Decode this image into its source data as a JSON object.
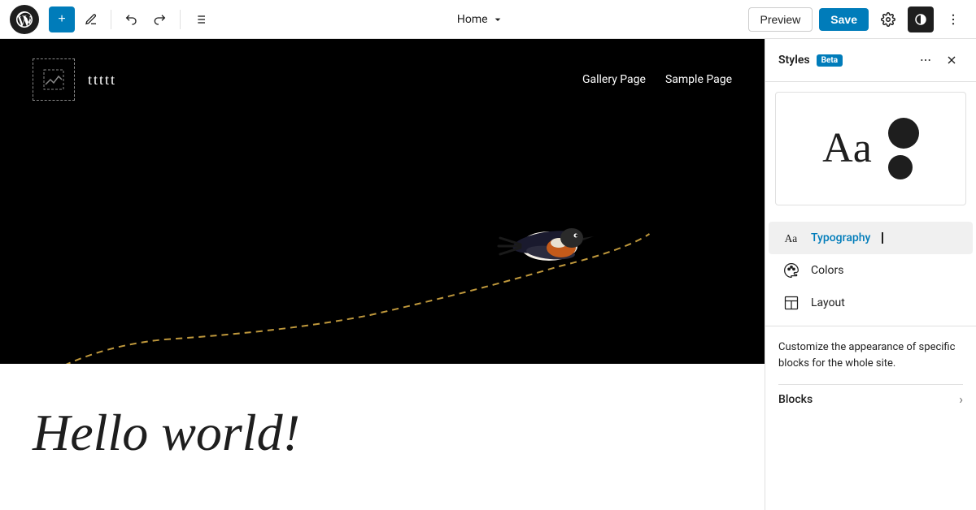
{
  "toolbar": {
    "add_label": "+",
    "nav_title": "Home",
    "preview_label": "Preview",
    "save_label": "Save"
  },
  "nav": {
    "title": "Home",
    "links": [
      "Gallery Page",
      "Sample Page"
    ]
  },
  "hero": {
    "site_title": "ttttt",
    "nav_link_1": "Gallery Page",
    "nav_link_2": "Sample Page"
  },
  "below_hero": {
    "heading": "Hello world!"
  },
  "right_panel": {
    "title": "Styles",
    "beta": "Beta",
    "typography_label": "Typography",
    "colors_label": "Colors",
    "layout_label": "Layout",
    "customize_text": "Customize the appearance of specific blocks for the whole site.",
    "blocks_label": "Blocks",
    "preview_text": "Aa"
  }
}
